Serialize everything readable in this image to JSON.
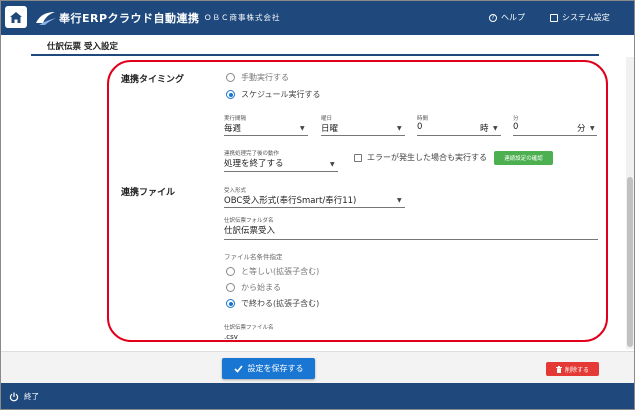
{
  "header": {
    "logo_text": "奉行ERPクラウド自動連携",
    "company": "ＯＢＣ商事株式会社",
    "help_label": "ヘルプ",
    "settings_label": "システム設定"
  },
  "page_title": "仕訳伝票 受入設定",
  "sync_timing": {
    "label": "連携タイミング",
    "option_manual": "手動実行する",
    "option_schedule": "スケジュール実行する",
    "selected": "スケジュール実行する",
    "interval_label": "実行間隔",
    "interval_value": "毎週",
    "weekday_label": "曜日",
    "weekday_value": "日曜",
    "hour_label": "時間",
    "hour_value": "0",
    "hour_unit": "時",
    "minute_label": "分",
    "minute_value": "0",
    "minute_unit": "分",
    "after_action_label": "連携処理完了後の動作",
    "after_action_value": "処理を終了する",
    "error_checkbox_label": "エラーが発生した場合も実行する",
    "error_checkbox_checked": false,
    "check_settings_button": "連続設定の確認"
  },
  "sync_file": {
    "label": "連携ファイル",
    "format_label": "受入形式",
    "format_value": "OBC受入形式(奉行Smart/奉行11)",
    "folder_label": "仕訳伝票フォルダ名",
    "folder_value": "仕訳伝票受入",
    "name_condition_heading": "ファイル名条件指定",
    "option_equal": "と等しい(拡張子含む)",
    "option_starts": "から始まる",
    "option_ends": "で終わる(拡張子含む)",
    "selected": "で終わる(拡張子含む)",
    "filename_label": "仕訳伝票ファイル名",
    "filename_value": ".csv"
  },
  "actions": {
    "save_label": "設定を保存する",
    "delete_label": "削除する"
  },
  "footer": {
    "exit_label": "終了"
  },
  "colors": {
    "header_bg": "#1f497d",
    "primary": "#1976d2",
    "danger": "#e53935",
    "success": "#4caf50",
    "highlight": "#e0001b"
  }
}
